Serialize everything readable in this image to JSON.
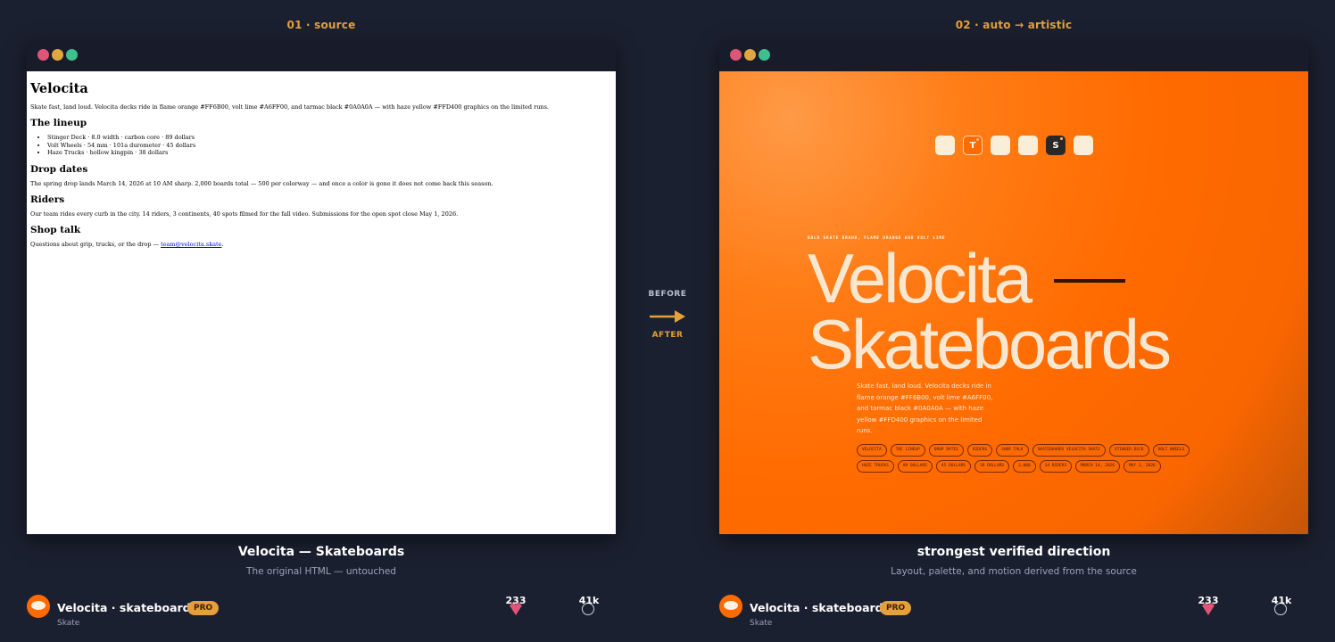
{
  "left": {
    "label": "01 · source",
    "source": {
      "title": "Velocita",
      "intro": "Skate fast, land loud. Velocita decks ride in flame orange #FF6B00, volt lime #A6FF00, and tarmac black #0A0A0A — with haze yellow #FFD400 graphics on the limited runs.",
      "lineup_heading": "The lineup",
      "lineup": [
        "Stinger Deck · 8.0 width · carbon core · 89 dollars",
        "Volt Wheels · 54 mm · 101a durometer · 45 dollars",
        "Haze Trucks · hollow kingpin · 38 dollars"
      ],
      "drop_heading": "Drop dates",
      "drop_text": "The spring drop lands March 14, 2026 at 10 AM sharp. 2,000 boards total — 500 per colorway — and once a color is gone it does not come back this season.",
      "riders_heading": "Riders",
      "riders_text": "Our team rides every curb in the city. 14 riders, 3 continents, 40 spots filmed for the fall video. Submissions for the open spot close May 1, 2026.",
      "shop_heading": "Shop talk",
      "shop_text": "Questions about grip, trucks, or the drop — ",
      "shop_link": "team@velocita.skate",
      "shop_end": "."
    },
    "caption_title": "Velocita — Skateboards",
    "caption_sub": "The original HTML — untouched",
    "footer": {
      "name": "Velocita · skateboards",
      "badge": "PRO",
      "sub": "Skate",
      "likes": "233",
      "views": "41k"
    }
  },
  "center": {
    "before": "BEFORE",
    "after": "AFTER"
  },
  "right": {
    "label": "02 · auto → artistic",
    "artistic": {
      "chips": [
        "",
        "T",
        "",
        "",
        "S",
        ""
      ],
      "eyebrow": "BOLD SKATE BRAND, FLAME ORANGE AND VOLT LIME",
      "hero_line1": "Velocita",
      "hero_line2": "Skateboards",
      "blurb": "Skate fast, land loud. Velocita decks ride in flame orange #FF6B00, volt lime #A6FF00, and tarmac black #0A0A0A — with haze yellow #FFD400 graphics on the limited runs.",
      "tags": [
        "VELOCITA",
        "THE LINEUP",
        "DROP DATES",
        "RIDERS",
        "SHOP TALK",
        "SKATEBOARDS VELOCITA SKATE",
        "STINGER DECK",
        "VOLT WHEELS",
        "HAZE TRUCKS",
        "89 DOLLARS",
        "45 DOLLARS",
        "38 DOLLARS",
        "2,000",
        "14 RIDERS",
        "MARCH 14, 2026",
        "MAY 1, 2026"
      ]
    },
    "caption_title": "strongest verified direction",
    "caption_sub": "Layout, palette, and motion derived from the source",
    "footer": {
      "name": "Velocita · skateboards",
      "badge": "PRO",
      "sub": "Skate",
      "likes": "233",
      "views": "41k"
    }
  },
  "colors": {
    "accent": "#e6a03b",
    "background": "#1b2030",
    "flame_orange": "#FF6B00",
    "heart": "#e05577"
  }
}
